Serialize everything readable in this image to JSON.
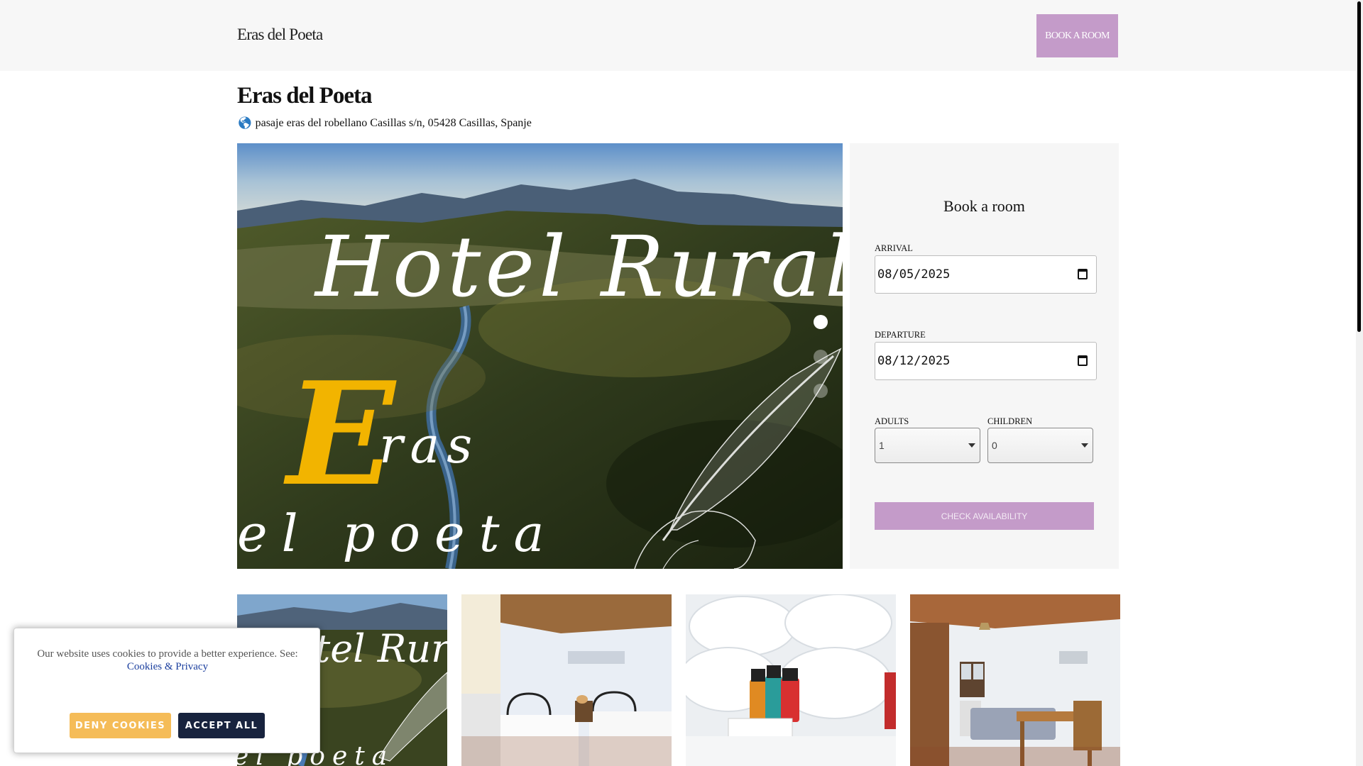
{
  "header": {
    "brand": "Eras del Poeta",
    "book_button": "BOOK A ROOM"
  },
  "hotel": {
    "title": "Eras del Poeta",
    "address": "pasaje eras del robellano Casillas s/n, 05428 Casillas, Spanje",
    "address_icon": "globe-icon"
  },
  "hero": {
    "logo_line1": "Hotel Rural",
    "logo_initial": "E",
    "logo_line2": "ras",
    "logo_line3": "el poeta",
    "slides_total": 3,
    "active_slide": 1
  },
  "booking": {
    "title": "Book a room",
    "arrival_label": "ARRIVAL",
    "arrival_value": "08/05/2025",
    "departure_label": "DEPARTURE",
    "departure_value": "08/12/2025",
    "adults_label": "ADULTS",
    "adults_value": "1",
    "children_label": "CHILDREN",
    "children_value": "0",
    "check_button": "CHECK AVAILABILITY"
  },
  "gallery": {
    "thumb1_text": "Hotel Rural",
    "thumb1_text2": "el poeta"
  },
  "cookie": {
    "message": "Our website uses cookies to provide a better experience. See:",
    "link": "Cookies & Privacy",
    "deny": "DENY COOKIES",
    "accept": "ACCEPT ALL"
  },
  "colors": {
    "accent": "#c49bc9",
    "deny": "#f5bc58",
    "accept": "#18233e",
    "logo_yellow": "#f2b400"
  }
}
